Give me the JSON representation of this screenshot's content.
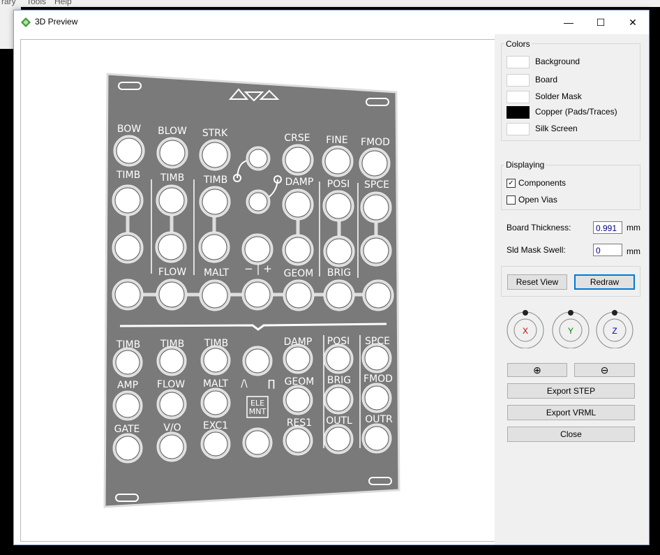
{
  "window": {
    "title": "3D Preview",
    "controls": {
      "minimize": "—",
      "maximize": "☐",
      "close": "✕"
    }
  },
  "background_app": {
    "menu": [
      "rary",
      "Tools",
      "Help"
    ]
  },
  "colors_group": {
    "title": "Colors",
    "items": [
      {
        "label": "Background",
        "color": "#ffffff"
      },
      {
        "label": "Board",
        "color": "#ffffff"
      },
      {
        "label": "Solder Mask",
        "color": "#ffffff"
      },
      {
        "label": "Copper (Pads/Traces)",
        "color": "#000000"
      },
      {
        "label": "Silk Screen",
        "color": "#ffffff"
      }
    ]
  },
  "displaying_group": {
    "title": "Displaying",
    "items": [
      {
        "label": "Components",
        "checked": true,
        "mark": "✓"
      },
      {
        "label": "Open Vias",
        "checked": false,
        "mark": ""
      }
    ]
  },
  "board_thickness": {
    "label": "Board Thickness:",
    "value": "0.991",
    "unit": "mm"
  },
  "sld_mask_swell": {
    "label": "Sld Mask Swell:",
    "value": "0",
    "unit": "mm"
  },
  "buttons": {
    "reset_view": "Reset View",
    "redraw": "Redraw",
    "zoom_in": "⊕",
    "zoom_out": "⊖",
    "export_step": "Export STEP",
    "export_vrml": "Export VRML",
    "close": "Close"
  },
  "rotation_dials": [
    {
      "label": "X",
      "color": "#d00000"
    },
    {
      "label": "Y",
      "color": "#008000"
    },
    {
      "label": "Z",
      "color": "#0000c0"
    }
  ],
  "panel": {
    "board_color": "#7a7a7a",
    "labels": [
      "BOW",
      "BLOW",
      "STRK",
      "CRSE",
      "FINE",
      "FMOD",
      "TIMB",
      "TIMB",
      "TIMB",
      "DAMP",
      "POSI",
      "SPCE",
      "FLOW",
      "MALT",
      "GEOM",
      "BRIG",
      "TIMB",
      "TIMB",
      "TIMB",
      "DAMP",
      "POSI",
      "SPCE",
      "AMP",
      "FLOW",
      "MALT",
      "GEOM",
      "BRIG",
      "FMOD",
      "GATE",
      "V/O",
      "EXC1",
      "RES1",
      "OUTL",
      "OUTR",
      "ELE",
      "MNT",
      "− | +",
      "/\\",
      "∏"
    ]
  }
}
